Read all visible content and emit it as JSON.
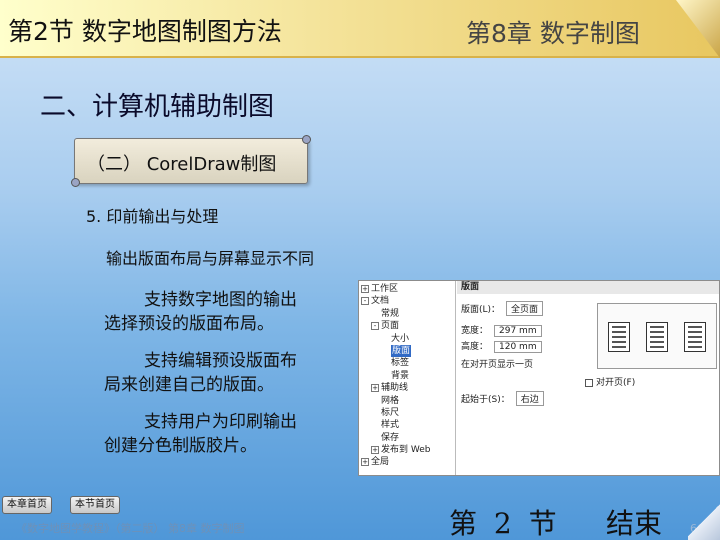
{
  "header": {
    "section_title": "第2节  数字地图制图方法",
    "chapter_title": "第8章  数字制图"
  },
  "heading": "二、计算机辅助制图",
  "scroll_label": "（二） CorelDraw制图",
  "item5": "5. 印前输出与处理",
  "subtitle": "输出版面布局与屏幕显示不同",
  "paragraphs": [
    {
      "line1": "支持数字地图的输出",
      "line2": "选择预设的版面布局。"
    },
    {
      "line1": "支持编辑预设版面布",
      "line2": "局来创建自己的版面。"
    },
    {
      "line1": "支持用户为印刷输出",
      "line2": "创建分色制版胶片。"
    }
  ],
  "dialog": {
    "tree": [
      {
        "sign": "+",
        "label": "工作区",
        "indent": 0
      },
      {
        "sign": "-",
        "label": "文档",
        "indent": 0
      },
      {
        "sign": "",
        "label": "常规",
        "indent": 1
      },
      {
        "sign": "-",
        "label": "页面",
        "indent": 1
      },
      {
        "sign": "",
        "label": "大小",
        "indent": 2
      },
      {
        "sign": "",
        "label": "版面",
        "indent": 2,
        "selected": true
      },
      {
        "sign": "",
        "label": "标签",
        "indent": 2
      },
      {
        "sign": "",
        "label": "背景",
        "indent": 2
      },
      {
        "sign": "+",
        "label": "辅助线",
        "indent": 1
      },
      {
        "sign": "",
        "label": "网格",
        "indent": 1
      },
      {
        "sign": "",
        "label": "标尺",
        "indent": 1
      },
      {
        "sign": "",
        "label": "样式",
        "indent": 1
      },
      {
        "sign": "",
        "label": "保存",
        "indent": 1
      },
      {
        "sign": "+",
        "label": "发布到 Web",
        "indent": 1
      },
      {
        "sign": "+",
        "label": "全局",
        "indent": 0
      }
    ],
    "panel_title": "版面",
    "layout_label": "版面(L)：",
    "layout_value": "全页面",
    "width_label": "宽度：",
    "width_value": "297 mm",
    "height_label": "高度：",
    "height_value": "120 mm",
    "facing_label": "在对开页显示一页",
    "facing_pages_label": "对开页(F)",
    "start_label": "起始于(S)：",
    "start_value": "右边"
  },
  "nav": {
    "chapter_home": "本章首页",
    "section_home": "本节首页"
  },
  "footer_info": "《数字地图学教程》（第二版） 第8章  数字制图",
  "section_end": "第 2 节",
  "end_label": "结束",
  "page_number": "66"
}
